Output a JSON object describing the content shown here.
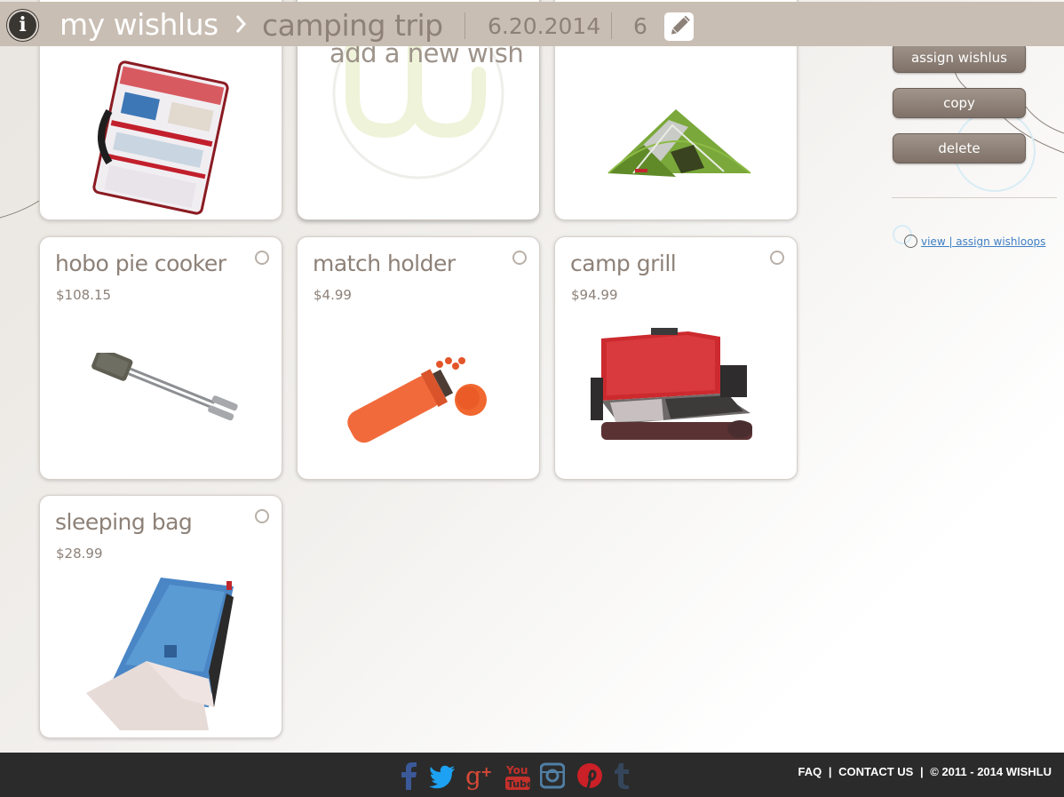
{
  "header": {
    "root_label": "my wishlus",
    "list_name": "camping trip",
    "date": "6.20.2014",
    "count": "6"
  },
  "cards": [
    {
      "title": "",
      "price": "",
      "image": "first-aid-kit"
    },
    {
      "title": "add a new wish",
      "price": "",
      "image": "wishlu-logo"
    },
    {
      "title": "",
      "price": "",
      "image": "tent"
    },
    {
      "title": "hobo pie cooker",
      "price": "$108.15",
      "image": "pie-iron"
    },
    {
      "title": "match holder",
      "price": "$4.99",
      "image": "match-holder"
    },
    {
      "title": "camp grill",
      "price": "$94.99",
      "image": "camp-grill"
    },
    {
      "title": "sleeping bag",
      "price": "$28.99",
      "image": "sleeping-bag"
    }
  ],
  "sidebar": {
    "assign_label": "assign wishlus",
    "copy_label": "copy",
    "delete_label": "delete",
    "loops_link": "view | assign wishloops"
  },
  "footer": {
    "faq": "FAQ",
    "contact": "CONTACT US",
    "copyright": "© 2011 - 2014 WISHLU",
    "social": [
      "facebook-icon",
      "twitter-icon",
      "google-plus-icon",
      "youtube-icon",
      "instagram-icon",
      "pinterest-icon",
      "tumblr-icon"
    ]
  },
  "colors": {
    "header_bg": "#c9beb3",
    "accent_text": "#8d8178",
    "button_brown": "#8a7d73",
    "footer_bg": "#2b2b2b",
    "link_blue": "#3e7fc4"
  }
}
